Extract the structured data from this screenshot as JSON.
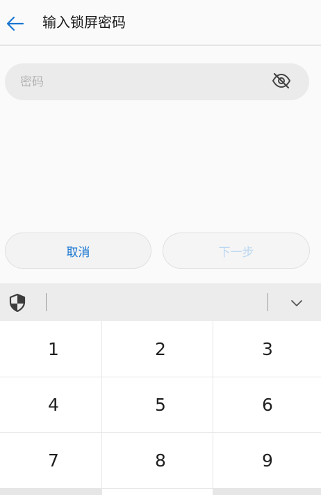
{
  "header": {
    "title": "输入锁屏密码"
  },
  "password": {
    "placeholder": "密码",
    "value": ""
  },
  "actions": {
    "cancel_label": "取消",
    "next_label": "下一步"
  },
  "keypad": {
    "keys": [
      "1",
      "2",
      "3",
      "4",
      "5",
      "6",
      "7",
      "8",
      "9"
    ]
  },
  "colors": {
    "accent": "#1976d2",
    "disabled_accent": "#bcd8f0",
    "field_bg": "#ebebeb",
    "toolbar_bg": "#ececec"
  },
  "icons": {
    "back": "arrow-left-icon",
    "visibility": "eye-off-icon",
    "secure_keyboard": "shield-icon",
    "collapse": "chevron-down-icon"
  }
}
